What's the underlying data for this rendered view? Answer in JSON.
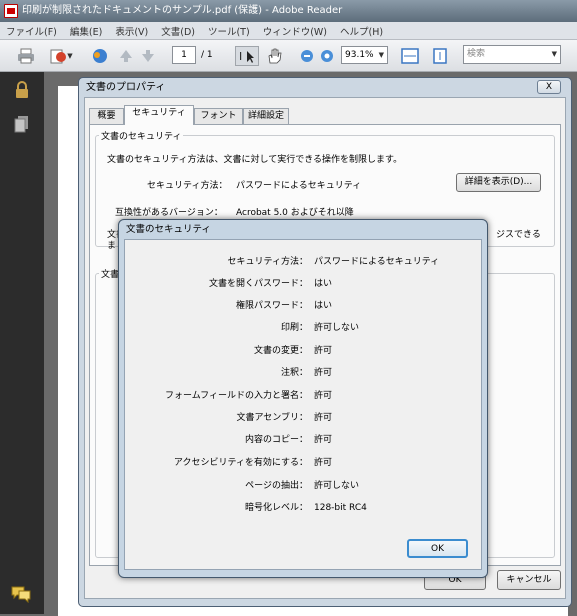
{
  "window": {
    "title": "印刷が制限されたドキュメントのサンプル.pdf (保護) - Adobe Reader"
  },
  "menu": [
    "ファイル(F)",
    "編集(E)",
    "表示(V)",
    "文書(D)",
    "ツール(T)",
    "ウィンドウ(W)",
    "ヘルプ(H)"
  ],
  "toolbar": {
    "page_current": "1",
    "page_total": "/ 1",
    "zoom": "93.1%",
    "search_placeholder": "検索"
  },
  "props": {
    "title": "文書のプロパティ",
    "close": "X",
    "tabs": [
      "概要",
      "セキュリティ",
      "フォント",
      "詳細設定"
    ],
    "active_tab": "セキュリティ",
    "group_label": "文書のセキュリティ",
    "description": "文書のセキュリティ方法は、文書に対して実行できる操作を制限します。",
    "method_label": "セキュリティ方法：",
    "method_value": "パスワードによるセキュリティ",
    "details_button": "詳細を表示(D)...",
    "compat_label": "互換性があるバージョン：",
    "compat_value": "Acrobat 5.0 およびそれ以降",
    "obscured_text": "文書",
    "obscured_text_2": "ま",
    "obscured_text_right": "ジスできる",
    "group2_label": "文書",
    "ok_button": "OK",
    "cancel_button": "キャンセル"
  },
  "dialog": {
    "title": "文書のセキュリティ",
    "rows": [
      {
        "label": "セキュリティ方法：",
        "value": "パスワードによるセキュリティ"
      },
      {
        "label": "文書を開くパスワード：",
        "value": "はい"
      },
      {
        "label": "権限パスワード：",
        "value": "はい"
      },
      {
        "label": "印刷：",
        "value": "許可しない"
      },
      {
        "label": "文書の変更：",
        "value": "許可"
      },
      {
        "label": "注釈：",
        "value": "許可"
      },
      {
        "label": "フォームフィールドの入力と署名：",
        "value": "許可"
      },
      {
        "label": "文書アセンブリ：",
        "value": "許可"
      },
      {
        "label": "内容のコピー：",
        "value": "許可"
      },
      {
        "label": "アクセシビリティを有効にする：",
        "value": "許可"
      },
      {
        "label": "ページの抽出：",
        "value": "許可しない"
      },
      {
        "label": "暗号化レベル：",
        "value": "128-bit RC4"
      }
    ],
    "ok_button": "OK"
  }
}
